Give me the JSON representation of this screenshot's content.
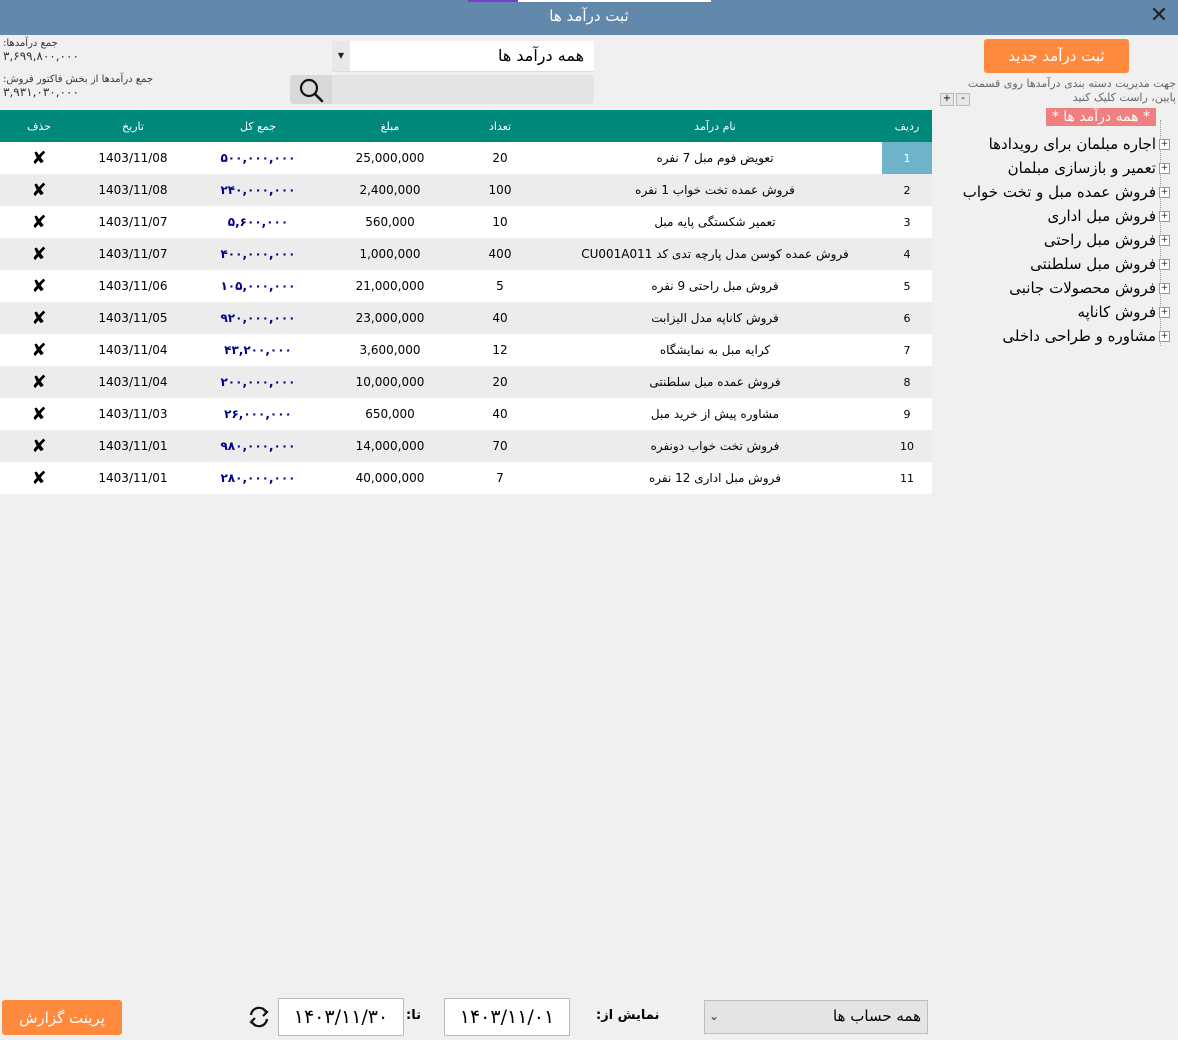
{
  "window": {
    "title": "ثبت درآمد ها",
    "close_icon": "close-icon"
  },
  "totals": {
    "income_label": "جمع درآمدها:",
    "income_value": "۳,۶۹۹,۸۰۰,۰۰۰",
    "invoice_label": "جمع درآمدها از بخش فاکتور فروش:",
    "invoice_value": "۳,۹۳۱,۰۳۰,۰۰۰"
  },
  "filter": {
    "category_selected": "همه درآمد ها",
    "search_placeholder": ""
  },
  "actions": {
    "new_income": "ثبت درآمد جدید",
    "print_report": "پرینت گزارش"
  },
  "tree": {
    "hint": "جهت مدیریت دسته بندی درآمدها روی قسمت پایین، راست کلیک کنید",
    "expand_all": "+",
    "collapse_all": "-",
    "root": "* همه درآمد ها *",
    "items": [
      "اجاره مبلمان برای رویدادها",
      "تعمیر و بازسازی مبلمان",
      "فروش عمده مبل و تخت خواب",
      "فروش مبل اداری",
      "فروش مبل راحتی",
      "فروش مبل سلطنتی",
      "فروش محصولات جانبی",
      "فروش کاناپه",
      "مشاوره و طراحی داخلی"
    ]
  },
  "table": {
    "headers": {
      "row": "ردیف",
      "name": "نام درآمد",
      "qty": "تعداد",
      "amount": "مبلغ",
      "total": "جمع کل",
      "date": "تاریخ",
      "delete": "حذف"
    },
    "rows": [
      {
        "row": "1",
        "name": "تعویض فوم مبل 7 نفره",
        "qty": "20",
        "amount": "25,000,000",
        "total": "۵۰۰,۰۰۰,۰۰۰",
        "date": "1403/11/08"
      },
      {
        "row": "2",
        "name": "فروش عمده تخت خواب 1 نفره",
        "qty": "100",
        "amount": "2,400,000",
        "total": "۲۴۰,۰۰۰,۰۰۰",
        "date": "1403/11/08"
      },
      {
        "row": "3",
        "name": "تعمیر شکستگی پایه مبل",
        "qty": "10",
        "amount": "560,000",
        "total": "۵,۶۰۰,۰۰۰",
        "date": "1403/11/07"
      },
      {
        "row": "4",
        "name": "فروش عمده کوسن مدل پارچه تدی کد CU001A011",
        "qty": "400",
        "amount": "1,000,000",
        "total": "۴۰۰,۰۰۰,۰۰۰",
        "date": "1403/11/07"
      },
      {
        "row": "5",
        "name": "فروش مبل راحتی 9 نفره",
        "qty": "5",
        "amount": "21,000,000",
        "total": "۱۰۵,۰۰۰,۰۰۰",
        "date": "1403/11/06"
      },
      {
        "row": "6",
        "name": "فروش کاناپه مدل الیزابت",
        "qty": "40",
        "amount": "23,000,000",
        "total": "۹۲۰,۰۰۰,۰۰۰",
        "date": "1403/11/05"
      },
      {
        "row": "7",
        "name": "کرایه مبل به نمایشگاه",
        "qty": "12",
        "amount": "3,600,000",
        "total": "۴۳,۲۰۰,۰۰۰",
        "date": "1403/11/04"
      },
      {
        "row": "8",
        "name": "فروش عمده مبل سلطنتی",
        "qty": "20",
        "amount": "10,000,000",
        "total": "۲۰۰,۰۰۰,۰۰۰",
        "date": "1403/11/04"
      },
      {
        "row": "9",
        "name": "مشاوره پیش از خرید مبل",
        "qty": "40",
        "amount": "650,000",
        "total": "۲۶,۰۰۰,۰۰۰",
        "date": "1403/11/03"
      },
      {
        "row": "10",
        "name": "فروش تخت خواب دونفره",
        "qty": "70",
        "amount": "14,000,000",
        "total": "۹۸۰,۰۰۰,۰۰۰",
        "date": "1403/11/01"
      },
      {
        "row": "11",
        "name": "فروش مبل اداری 12 نفره",
        "qty": "7",
        "amount": "40,000,000",
        "total": "۲۸۰,۰۰۰,۰۰۰",
        "date": "1403/11/01"
      }
    ],
    "delete_icon": "✘",
    "selected_row": "1"
  },
  "footer": {
    "account_selected": "همه حساب ها",
    "show_from_label": "نمایش از:",
    "date_from": "۱۴۰۳/۱۱/۰۱",
    "to_label": "تا:",
    "date_to": "۱۴۰۳/۱۱/۳۰"
  },
  "colors": {
    "titlebar": "#6288ab",
    "header": "#00897b",
    "orange_button": "#ff8a3d",
    "total_text": "#00008b",
    "tree_root": "#f08080",
    "selected_cell": "#6fb3c9"
  }
}
